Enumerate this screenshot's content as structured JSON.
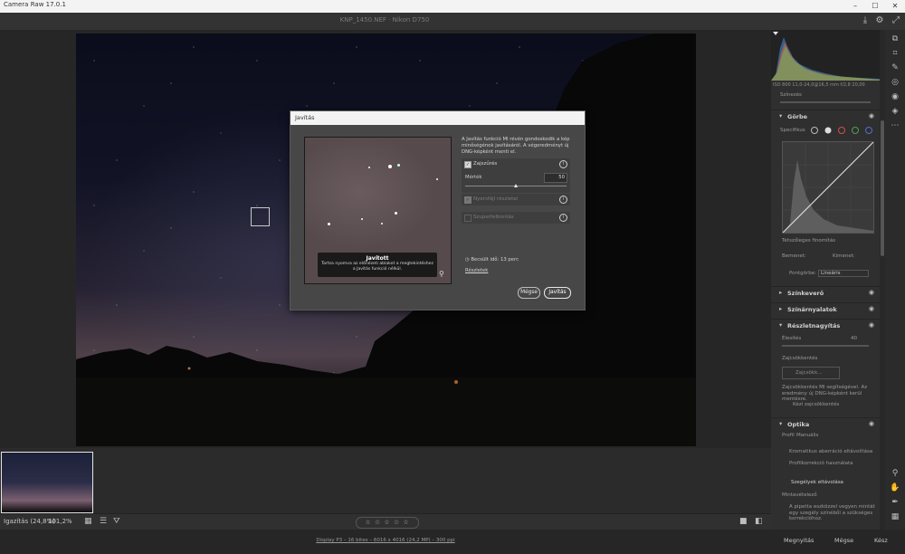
{
  "window": {
    "title": "Camera Raw 17.0.1"
  },
  "topbar": {
    "file_info": "KNP_1450.NEF  ·  Nikon D750"
  },
  "status": {
    "zoom_label": "Igazítás (24,8%)",
    "zoom_value": "101,2%",
    "rating": "☆ ☆ ☆ ☆ ☆"
  },
  "bottombar": {
    "image_info": "Display P3 – 16 bites – 6016 x 4016 (24,2 MP) – 300 ppi",
    "open_label": "Megnyitás",
    "cancel_label": "Mégse",
    "done_label": "Kész"
  },
  "histogram": {
    "info": "ISO 800   11,0-24,0@16,5 mm   f/2,8   20,00"
  },
  "panel": {
    "top_slider": "Színezés",
    "curve": {
      "title": "Görbe",
      "channel_label": "Specifikus",
      "footer": "Tetszőleges finomítás",
      "black_label": "Bemenet:",
      "white_label": "Kimenet:",
      "preset_label": "Pontgörbe:",
      "preset_value": "Lineáris"
    },
    "color_mixer": "Színkeverő",
    "color_grading": "Színárnyalatok",
    "detail": {
      "title": "Részletnagyítás",
      "sharpen_label": "Élesítés",
      "sharpen_value": "40",
      "noise_label": "Zajcsökkentés",
      "noise_button": "Zajcsökk...",
      "noise_desc": "Zajcsökkentés MI segítségével. Az eredmény új DNG-képként kerül mentésre.",
      "manual_label": "Kézi zajcsökkentés"
    },
    "optics": {
      "title": "Optika",
      "profile_label": "Profil",
      "manual_label": "Manuális",
      "ca_label": "Kromatikus aberráció eltávolítása",
      "profile_corr_label": "Profilkorrekció használata",
      "defringe_label": "Szegélyek eltávolása",
      "sample_label": "Mintavételező",
      "desc": "A pipetta eszközzel vegyen mintát egy szegély színéből a szükséges korrekcióhoz."
    }
  },
  "dialog": {
    "title": "Javítás",
    "description": "A Javítás funkció MI révén gondoskodik a kép minőségének javításáról. A végeredményt új DNG-képként menti el.",
    "tooltip_title": "Javított",
    "tooltip_body_1": "Tartsa nyomva az előnézeti ablakot a megtekintéshez",
    "tooltip_body_2": "a Javítás funkció nélkül.",
    "denoise": {
      "label": "Zajszűrés",
      "checked": true,
      "amount_label": "Mérték",
      "amount_value": "50",
      "amount_fraction": 0.5
    },
    "raw_details": {
      "label": "Nyersfájl részletei",
      "checked": true,
      "enabled": false
    },
    "super_res": {
      "label": "Szuperfelbontás",
      "checked": false,
      "enabled": false
    },
    "estimate": "Becsült idő: 13 perc",
    "details_link": "Részletek",
    "cancel_label": "Mégse",
    "enhance_label": "Javítás"
  },
  "icons": {
    "info": "ⓘ",
    "clock": "◷",
    "zoom": "⚲",
    "eye": "◉",
    "check": "✓"
  }
}
